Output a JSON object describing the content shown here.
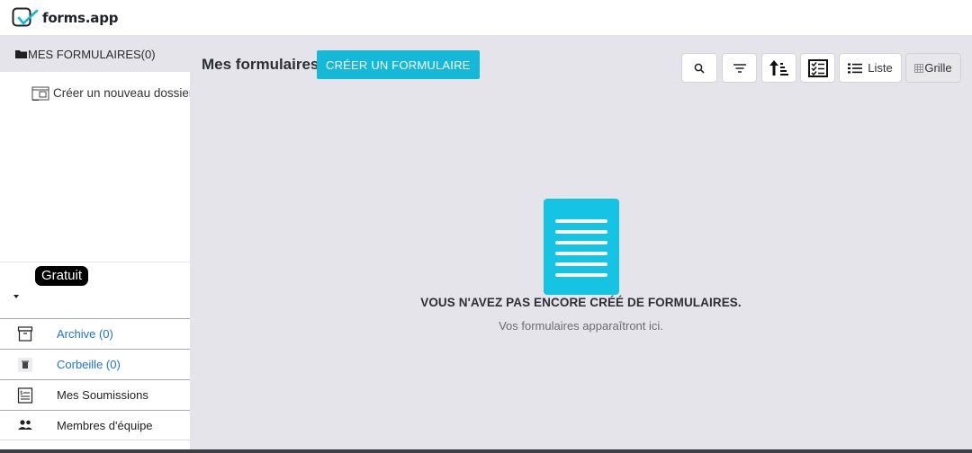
{
  "app": {
    "logo_text": "forms.app"
  },
  "sidebar": {
    "header": "MES FORMULAIRES(0)",
    "new_folder": "Créer un nouveau dossier",
    "plan_badge": "Gratuit",
    "nav": [
      {
        "label": "Archive (0)",
        "icon": "archive-icon"
      },
      {
        "label": "Corbeille (0)",
        "icon": "trash-icon"
      },
      {
        "label": "Mes Soumissions",
        "icon": "submissions-icon"
      },
      {
        "label": "Membres d'équipe",
        "icon": "team-icon"
      }
    ]
  },
  "main": {
    "title": "Mes formulaires",
    "create_button": "CRÉER UN FORMULAIRE",
    "toolbar": {
      "list_label": "Liste",
      "grid_label": "Grille"
    },
    "empty_state": {
      "title": "VOUS N'AVEZ PAS ENCORE CRÉÉ DE FORMULAIRES.",
      "subtitle": "Vos formulaires apparaîtront ici."
    }
  },
  "colors": {
    "accent": "#15b8d6",
    "doc_icon": "#15c3e2",
    "link": "#1a74d6",
    "main_bg": "#e4e4ea"
  }
}
